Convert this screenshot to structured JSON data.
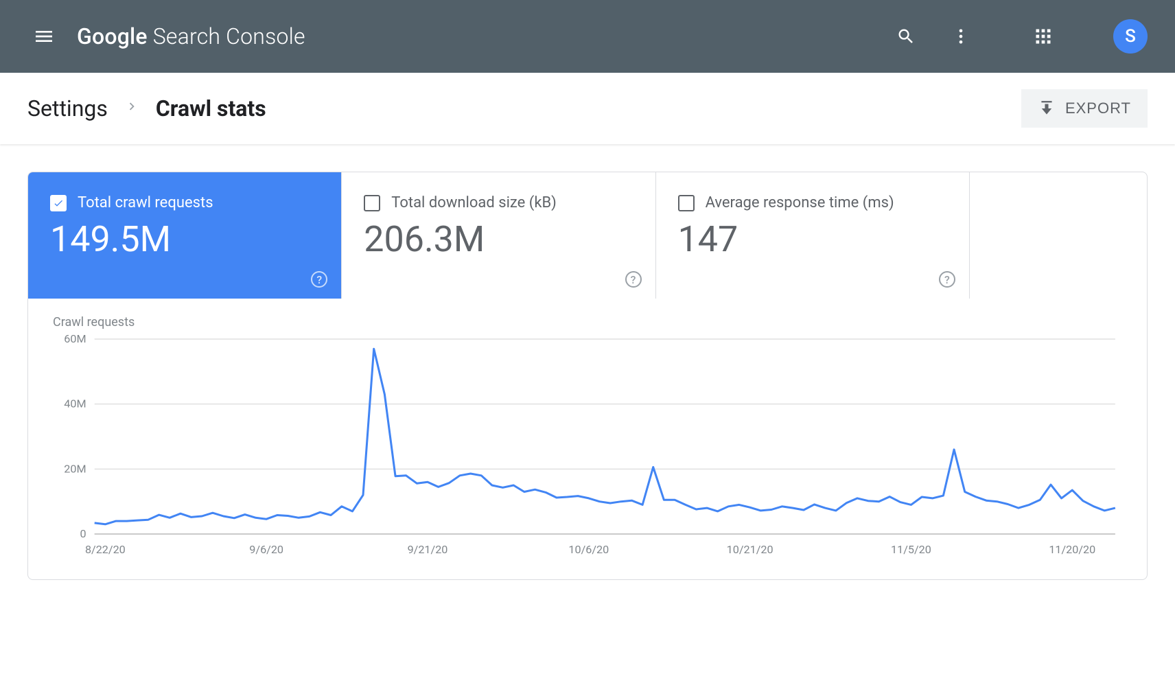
{
  "header": {
    "app_name_google": "Google",
    "app_name_product": "Search Console",
    "avatar_letter": "S"
  },
  "breadcrumb": {
    "parent": "Settings",
    "current": "Crawl stats"
  },
  "export": {
    "label": "EXPORT"
  },
  "metrics": [
    {
      "label": "Total crawl requests",
      "value": "149.5M",
      "active": true
    },
    {
      "label": "Total download size (kB)",
      "value": "206.3M",
      "active": false
    },
    {
      "label": "Average response time (ms)",
      "value": "147",
      "active": false
    }
  ],
  "chart": {
    "title": "Crawl requests"
  },
  "chart_data": {
    "type": "line",
    "title": "Crawl requests",
    "xlabel": "",
    "ylabel": "",
    "ylim": [
      0,
      60
    ],
    "y_ticks": [
      "0",
      "20M",
      "40M",
      "60M"
    ],
    "x_tick_labels": [
      "8/22/20",
      "9/6/20",
      "9/21/20",
      "10/6/20",
      "10/21/20",
      "11/5/20",
      "11/20/20"
    ],
    "x_tick_indices": [
      1,
      16,
      31,
      46,
      61,
      76,
      91
    ],
    "series": [
      {
        "name": "Crawl requests (M)",
        "values": [
          3.4,
          3.0,
          4.0,
          4.0,
          4.2,
          4.4,
          5.9,
          5.0,
          6.3,
          5.2,
          5.5,
          6.5,
          5.5,
          4.9,
          6.0,
          5.0,
          4.6,
          5.8,
          5.6,
          5.0,
          5.4,
          6.7,
          5.8,
          8.5,
          7.0,
          12.0,
          57.0,
          43.0,
          17.8,
          18.0,
          15.6,
          16.0,
          14.5,
          15.7,
          18.0,
          18.6,
          18.0,
          15.0,
          14.3,
          15.0,
          13.0,
          13.7,
          12.8,
          11.2,
          11.4,
          11.7,
          11.0,
          10.0,
          9.5,
          10.0,
          10.3,
          9.0,
          20.6,
          10.5,
          10.5,
          9.0,
          7.6,
          8.0,
          7.0,
          8.5,
          9.0,
          8.2,
          7.2,
          7.5,
          8.5,
          8.0,
          7.4,
          9.1,
          8.0,
          7.2,
          9.6,
          11.0,
          10.2,
          10.0,
          11.5,
          9.8,
          9.0,
          11.4,
          11.0,
          11.8,
          26.0,
          13.0,
          11.5,
          10.3,
          10.0,
          9.2,
          8.0,
          9.0,
          10.5,
          15.2,
          11.0,
          13.5,
          10.2,
          8.5,
          7.2,
          8.0
        ]
      }
    ]
  }
}
